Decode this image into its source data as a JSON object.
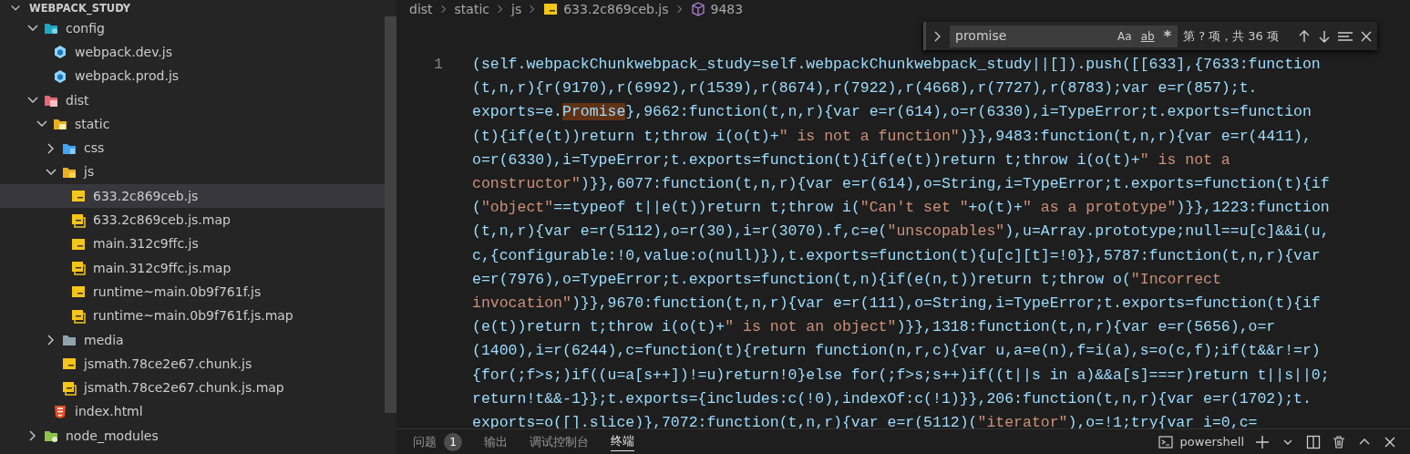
{
  "explorer": {
    "title": "WEBPACK_STUDY",
    "tree": [
      {
        "name": "config",
        "expanded": true,
        "selected": false,
        "children": [
          {
            "name": "webpack.dev.js",
            "selected": false
          },
          {
            "name": "webpack.prod.js",
            "selected": false
          }
        ]
      },
      {
        "name": "dist",
        "expanded": true,
        "selected": false,
        "children": [
          {
            "name": "static",
            "expanded": true,
            "selected": false,
            "children": [
              {
                "name": "css",
                "expanded": false,
                "selected": false
              },
              {
                "name": "js",
                "expanded": true,
                "selected": false,
                "children": [
                  {
                    "name": "633.2c869ceb.js",
                    "selected": true
                  },
                  {
                    "name": "633.2c869ceb.js.map",
                    "selected": false
                  },
                  {
                    "name": "main.312c9ffc.js",
                    "selected": false
                  },
                  {
                    "name": "main.312c9ffc.js.map",
                    "selected": false
                  },
                  {
                    "name": "runtime~main.0b9f761f.js",
                    "selected": false
                  },
                  {
                    "name": "runtime~main.0b9f761f.js.map",
                    "selected": false
                  }
                ]
              },
              {
                "name": "media",
                "expanded": false,
                "selected": false
              },
              {
                "name": "jsmath.78ce2e67.chunk.js",
                "selected": false
              },
              {
                "name": "jsmath.78ce2e67.chunk.js.map",
                "selected": false
              }
            ]
          },
          {
            "name": "index.html",
            "selected": false
          }
        ]
      },
      {
        "name": "node_modules",
        "expanded": false,
        "selected": false
      }
    ]
  },
  "breadcrumbs": [
    "dist",
    "static",
    "js",
    "633.2c869ceb.js",
    "9483"
  ],
  "find": {
    "value": "promise",
    "options": [
      "Aa",
      "ab",
      "*"
    ],
    "result": "第 ? 项，共 36 项"
  },
  "editor": {
    "line_number": "1",
    "lines": [
      {
        "parts": [
          {
            "text": "(self.webpackChunkwebpack_study=self.webpackChunkwebpack_study||[]).push([[633],{7633:function",
            "match": false
          }
        ]
      },
      {
        "parts": [
          {
            "text": "(t,n,r){r(9170),r(6992),r(1539),r(8674),r(7922),r(4668),r(7727),r(8783);var e=r(857);t.",
            "match": false
          }
        ]
      },
      {
        "parts": [
          {
            "text": "exports=e.",
            "match": false
          },
          {
            "text": "Promise",
            "match": true
          },
          {
            "text": "},9662:function(t,n,r){var e=r(614),o=r(6330),i=TypeError;t.exports=function",
            "match": false
          }
        ]
      },
      {
        "parts": [
          {
            "text": "(t){if(e(t))return t;throw i(o(t)+\" is not a function\")}},9483:function(t,n,r){var e=r(4411),",
            "match": false
          }
        ]
      },
      {
        "parts": [
          {
            "text": "o=r(6330),i=TypeError;t.exports=function(t){if(e(t))return t;throw i(o(t)+\" is not a",
            "match": false
          }
        ]
      },
      {
        "parts": [
          {
            "text": "constructor\")}},6077:function(t,n,r){var e=r(614),o=String,i=TypeError;t.exports=function(t){if",
            "match": false
          }
        ]
      },
      {
        "parts": [
          {
            "text": "(\"object\"==typeof t||e(t))return t;throw i(\"Can't set \"+o(t)+\" as a prototype\")}},1223:function",
            "match": false
          }
        ]
      },
      {
        "parts": [
          {
            "text": "(t,n,r){var e=r(5112),o=r(30),i=r(3070).f,c=e(\"unscopables\"),u=Array.prototype;null==u[c]&&i(u,",
            "match": false
          }
        ]
      },
      {
        "parts": [
          {
            "text": "c,{configurable:!0,value:o(null)}),t.exports=function(t){u[c][t]=!0}},5787:function(t,n,r){var",
            "match": false
          }
        ]
      },
      {
        "parts": [
          {
            "text": "e=r(7976),o=TypeError;t.exports=function(t,n){if(e(n,t))return t;throw o(\"Incorrect",
            "match": false
          }
        ]
      },
      {
        "parts": [
          {
            "text": "invocation\")}},9670:function(t,n,r){var e=r(111),o=String,i=TypeError;t.exports=function(t){if",
            "match": false
          }
        ]
      },
      {
        "parts": [
          {
            "text": "(e(t))return t;throw i(o(t)+\" is not an object\")}},1318:function(t,n,r){var e=r(5656),o=r",
            "match": false
          }
        ]
      },
      {
        "parts": [
          {
            "text": "(1400),i=r(6244),c=function(t){return function(n,r,c){var u,a=e(n),f=i(a),s=o(c,f);if(t&&r!=r)",
            "match": false
          }
        ]
      },
      {
        "parts": [
          {
            "text": "{for(;f>s;)if((u=a[s++])!=u)return!0}else for(;f>s;s++)if((t||s in a)&&a[s]===r)return t||s||0;",
            "match": false
          }
        ]
      },
      {
        "parts": [
          {
            "text": "return!t&&-1}};t.exports={includes:c(!0),indexOf:c(!1)}},206:function(t,n,r){var e=r(1702);t.",
            "match": false
          }
        ]
      },
      {
        "parts": [
          {
            "text": "exports=o([].slice)},7072:function(t,n,r){var e=r(5112)(\"iterator\"),o=!1;try{var i=0,c=",
            "match": false
          }
        ]
      }
    ]
  },
  "panel": {
    "tabs": [
      {
        "label": "问题",
        "badge": "1",
        "selected": false
      },
      {
        "label": "输出",
        "selected": false
      },
      {
        "label": "调试控制台",
        "selected": false
      },
      {
        "label": "终端",
        "selected": true
      }
    ],
    "terminal": "powershell"
  }
}
